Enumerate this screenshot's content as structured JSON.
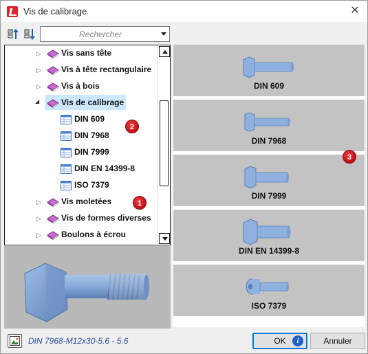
{
  "window": {
    "title": "Vis de calibrage",
    "close_icon": "close-icon"
  },
  "toolbar": {
    "search_placeholder": "Rechercher"
  },
  "tree": {
    "items": [
      {
        "label": "Vis sans tête",
        "level": 1,
        "icon": "book-icon",
        "expander": "collapsed"
      },
      {
        "label": "Vis à tête rectangulaire",
        "level": 1,
        "icon": "book-icon",
        "expander": "collapsed"
      },
      {
        "label": "Vis à bois",
        "level": 1,
        "icon": "book-icon",
        "expander": "collapsed"
      },
      {
        "label": "Vis de calibrage",
        "level": 1,
        "icon": "book-icon",
        "expander": "expanded",
        "selected": true
      },
      {
        "label": "DIN 609",
        "level": 2,
        "icon": "table-icon"
      },
      {
        "label": "DIN 7968",
        "level": 2,
        "icon": "table-icon"
      },
      {
        "label": "DIN 7999",
        "level": 2,
        "icon": "table-icon"
      },
      {
        "label": "DIN EN 14399-8",
        "level": 2,
        "icon": "table-icon"
      },
      {
        "label": "ISO 7379",
        "level": 2,
        "icon": "table-icon"
      },
      {
        "label": "Vis moletées",
        "level": 1,
        "icon": "book-icon",
        "expander": "collapsed"
      },
      {
        "label": "Vis de formes diverses",
        "level": 1,
        "icon": "book-icon",
        "expander": "collapsed"
      },
      {
        "label": "Boulons à écrou",
        "level": 1,
        "icon": "book-icon",
        "expander": "collapsed"
      }
    ]
  },
  "parts": [
    {
      "label": "DIN 609"
    },
    {
      "label": "DIN 7968"
    },
    {
      "label": "DIN 7999"
    },
    {
      "label": "DIN EN 14399-8"
    },
    {
      "label": "ISO 7379"
    }
  ],
  "badges": [
    "1",
    "2",
    "3"
  ],
  "status": {
    "text": "DIN 7968-M12x30-5.6 - 5.6"
  },
  "buttons": {
    "ok": "OK",
    "cancel": "Annuler"
  },
  "colors": {
    "selection": "#cce8ff",
    "badge": "#d01820",
    "bolt": "#7fa6d6",
    "status_text": "#2b4a9a"
  }
}
